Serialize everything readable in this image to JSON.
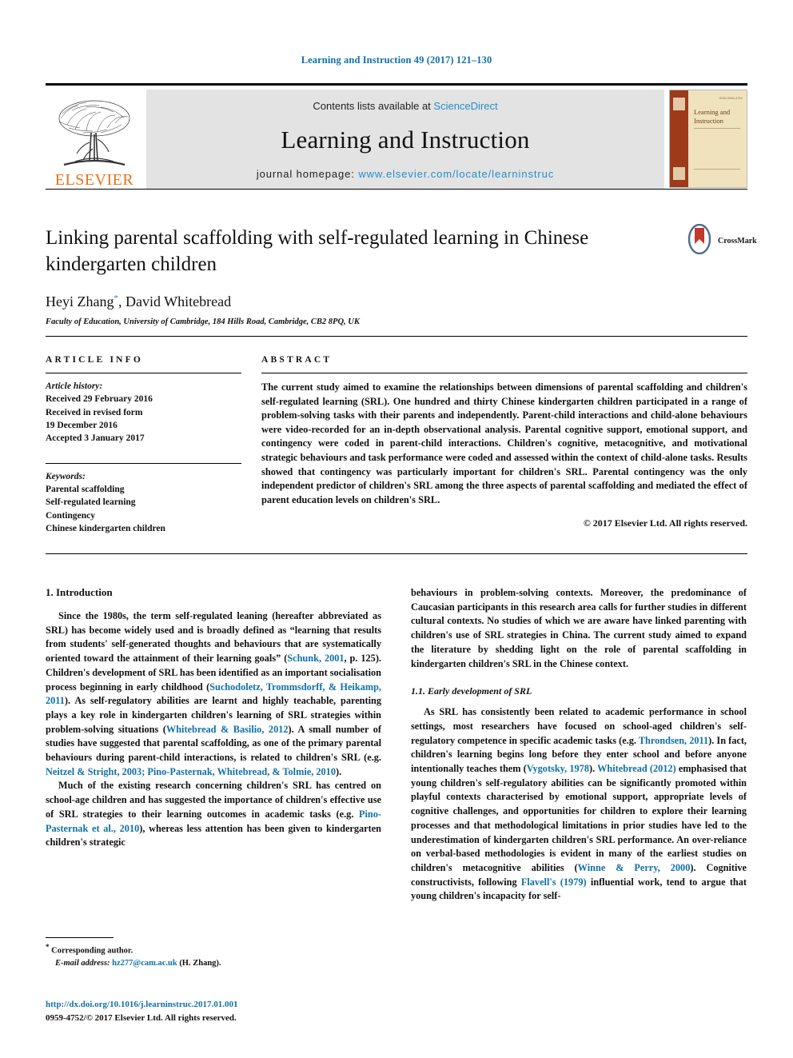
{
  "running_head": "Learning and Instruction 49 (2017) 121–130",
  "masthead": {
    "publisher_logo_text": "ELSEVIER",
    "contents_prefix": "Contents lists available at ",
    "contents_link": "ScienceDirect",
    "journal_name": "Learning and Instruction",
    "homepage_prefix": "journal homepage: ",
    "homepage_url": "www.elsevier.com/locate/learninstruc",
    "cover_title": "Learning and Instruction",
    "cover_corner_text": "ISSN 0959-4752"
  },
  "article": {
    "title": "Linking parental scaffolding with self-regulated learning in Chinese kindergarten children",
    "authors": "Heyi Zhang, David Whitebread",
    "author_marker": "*",
    "affiliation": "Faculty of Education, University of Cambridge, 184 Hills Road, Cambridge, CB2 8PQ, UK",
    "crossmark_label": "CrossMark"
  },
  "article_info": {
    "heading": "ARTICLE INFO",
    "history_label": "Article history:",
    "history_lines": [
      "Received 29 February 2016",
      "Received in revised form",
      "19 December 2016",
      "Accepted 3 January 2017"
    ],
    "keywords_label": "Keywords:",
    "keywords": [
      "Parental scaffolding",
      "Self-regulated learning",
      "Contingency",
      "Chinese kindergarten children"
    ]
  },
  "abstract": {
    "heading": "ABSTRACT",
    "text": "The current study aimed to examine the relationships between dimensions of parental scaffolding and children's self-regulated learning (SRL). One hundred and thirty Chinese kindergarten children participated in a range of problem-solving tasks with their parents and independently. Parent-child interactions and child-alone behaviours were video-recorded for an in-depth observational analysis. Parental cognitive support, emotional support, and contingency were coded in parent-child interactions. Children's cognitive, metacognitive, and motivational strategic behaviours and task performance were coded and assessed within the context of child-alone tasks. Results showed that contingency was particularly important for children's SRL. Parental contingency was the only independent predictor of children's SRL among the three aspects of parental scaffolding and mediated the effect of parent education levels on children's SRL.",
    "copyright": "© 2017 Elsevier Ltd. All rights reserved."
  },
  "body": {
    "section1_heading": "1. Introduction",
    "left_p1_a": "Since the 1980s, the term self-regulated leaning (hereafter abbreviated as SRL) has become widely used and is broadly defined as “learning that results from students' self-generated thoughts and behaviours that are systematically oriented toward the attainment of their learning goals” (",
    "left_p1_ref1": "Schunk, 2001",
    "left_p1_b": ", p. 125). Children's development of SRL has been identified as an important socialisation process beginning in early childhood (",
    "left_p1_ref2": "Suchodoletz, Trommsdorff, & Heikamp, 2011",
    "left_p1_c": "). As self-regulatory abilities are learnt and highly teachable, parenting plays a key role in kindergarten children's learning of SRL strategies within problem-solving situations (",
    "left_p1_ref3": "Whitebread & Basilio, 2012",
    "left_p1_d": "). A small number of studies have suggested that parental scaffolding, as one of the primary parental behaviours during parent-child interactions, is related to children's SRL (e.g. ",
    "left_p1_ref4": "Neitzel & Stright, 2003; Pino-Pasternak, Whitebread, & Tolmie, 2010",
    "left_p1_e": ").",
    "left_p2_a": "Much of the existing research concerning children's SRL has centred on school-age children and has suggested the importance of children's effective use of SRL strategies to their learning outcomes in academic tasks (e.g. ",
    "left_p2_ref1": "Pino-Pasternak et al., 2010",
    "left_p2_b": "), whereas less attention has been given to kindergarten children's strategic",
    "right_p1": "behaviours in problem-solving contexts. Moreover, the predominance of Caucasian participants in this research area calls for further studies in different cultural contexts. No studies of which we are aware have linked parenting with children's use of SRL strategies in China. The current study aimed to expand the literature by shedding light on the role of parental scaffolding in kindergarten children's SRL in the Chinese context.",
    "section11_heading": "1.1. Early development of SRL",
    "right_p2_a": "As SRL has consistently been related to academic performance in school settings, most researchers have focused on school-aged children's self-regulatory competence in specific academic tasks (e.g. ",
    "right_p2_ref1": "Throndsen, 2011",
    "right_p2_b": "). In fact, children's learning begins long before they enter school and before anyone intentionally teaches them (",
    "right_p2_ref2": "Vygotsky, 1978",
    "right_p2_c": "). ",
    "right_p2_ref3": "Whitebread (2012)",
    "right_p2_d": " emphasised that young children's self-regulatory abilities can be significantly promoted within playful contexts characterised by emotional support, appropriate levels of cognitive challenges, and opportunities for children to explore their learning processes and that methodological limitations in prior studies have led to the underestimation of kindergarten children's SRL performance. An over-reliance on verbal-based methodologies is evident in many of the earliest studies on children's metacognitive abilities (",
    "right_p2_ref4": "Winne & Perry, 2000",
    "right_p2_e": "). Cognitive constructivists, following ",
    "right_p2_ref5": "Flavell's (1979)",
    "right_p2_f": " influential work, tend to argue that young children's incapacity for self-"
  },
  "footer": {
    "corresponding_marker": "*",
    "corresponding_label": "Corresponding author.",
    "email_label": "E-mail address:",
    "email": "hz277@cam.ac.uk",
    "email_suffix": "(H. Zhang).",
    "doi": "http://dx.doi.org/10.1016/j.learninstruc.2017.01.001",
    "issn_line": "0959-4752/© 2017 Elsevier Ltd. All rights reserved."
  },
  "colors": {
    "link": "#1070a8",
    "sciencedirect": "#1f8fc9",
    "elsevier_orange": "#E9711C",
    "band_grey": "#e3e3e3",
    "cover_spine": "#9c3a1a",
    "cover_body": "#efe2bd"
  }
}
